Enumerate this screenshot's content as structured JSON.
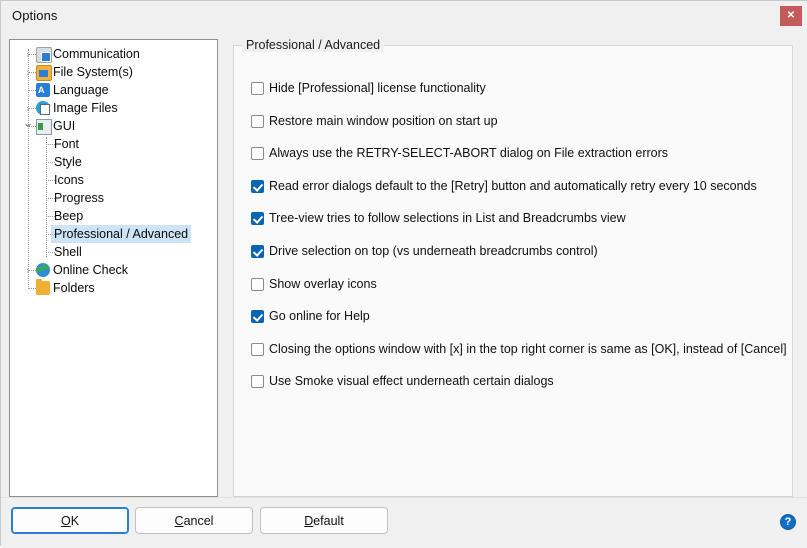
{
  "window": {
    "title": "Options",
    "close_label": "✕"
  },
  "tree": {
    "nodes": [
      {
        "label": "Communication",
        "level": 0,
        "icon": "settings-gear-icon",
        "expander": "collapsed",
        "selected": false
      },
      {
        "label": "File System(s)",
        "level": 0,
        "icon": "file-system-icon",
        "expander": "collapsed",
        "selected": false
      },
      {
        "label": "Language",
        "level": 0,
        "icon": "language-icon",
        "expander": "none",
        "selected": false
      },
      {
        "label": "Image Files",
        "level": 0,
        "icon": "image-files-icon",
        "expander": "collapsed",
        "selected": false
      },
      {
        "label": "GUI",
        "level": 0,
        "icon": "gui-window-icon",
        "expander": "expanded",
        "selected": false
      },
      {
        "label": "Font",
        "level": 1,
        "icon": "none",
        "expander": "none",
        "selected": false
      },
      {
        "label": "Style",
        "level": 1,
        "icon": "none",
        "expander": "none",
        "selected": false
      },
      {
        "label": "Icons",
        "level": 1,
        "icon": "none",
        "expander": "none",
        "selected": false
      },
      {
        "label": "Progress",
        "level": 1,
        "icon": "none",
        "expander": "none",
        "selected": false
      },
      {
        "label": "Beep",
        "level": 1,
        "icon": "none",
        "expander": "none",
        "selected": false
      },
      {
        "label": "Professional / Advanced",
        "level": 1,
        "icon": "none",
        "expander": "none",
        "selected": true
      },
      {
        "label": "Shell",
        "level": 1,
        "icon": "none",
        "expander": "none",
        "selected": false
      },
      {
        "label": "Online Check",
        "level": 0,
        "icon": "globe-icon",
        "expander": "collapsed",
        "selected": false
      },
      {
        "label": "Folders",
        "level": 0,
        "icon": "folder-icon",
        "expander": "none",
        "selected": false
      }
    ]
  },
  "group": {
    "title": "Professional / Advanced",
    "options": [
      {
        "label": "Hide [Professional] license functionality",
        "checked": false
      },
      {
        "label": "Restore main window position on start up",
        "checked": false
      },
      {
        "label": "Always use the RETRY-SELECT-ABORT dialog on File extraction errors",
        "checked": false
      },
      {
        "label": "Read error dialogs default to the [Retry] button and automatically retry every 10 seconds",
        "checked": true
      },
      {
        "label": "Tree-view tries to follow selections in List and Breadcrumbs view",
        "checked": true
      },
      {
        "label": "Drive selection on top (vs underneath breadcrumbs control)",
        "checked": true
      },
      {
        "label": "Show overlay icons",
        "checked": false
      },
      {
        "label": "Go online for Help",
        "checked": true
      },
      {
        "label": "Closing the options window with [x] in the top right corner is same as [OK], instead of [Cancel]",
        "checked": false
      },
      {
        "label": "Use Smoke visual effect underneath certain dialogs",
        "checked": false
      }
    ]
  },
  "footer": {
    "buttons": [
      {
        "name": "ok",
        "accel": "O",
        "rest": "K",
        "primary": true
      },
      {
        "name": "cancel",
        "accel": "C",
        "rest": "ancel",
        "primary": false
      },
      {
        "name": "default",
        "accel": "D",
        "rest": "efault",
        "primary": false
      }
    ],
    "help_label": "?"
  },
  "colors": {
    "accent": "#0a64b4",
    "selection": "#cde4f7",
    "close_button": "#c45b5b",
    "help_button": "#1170c4",
    "dialog_bg": "#f0f0f0"
  }
}
